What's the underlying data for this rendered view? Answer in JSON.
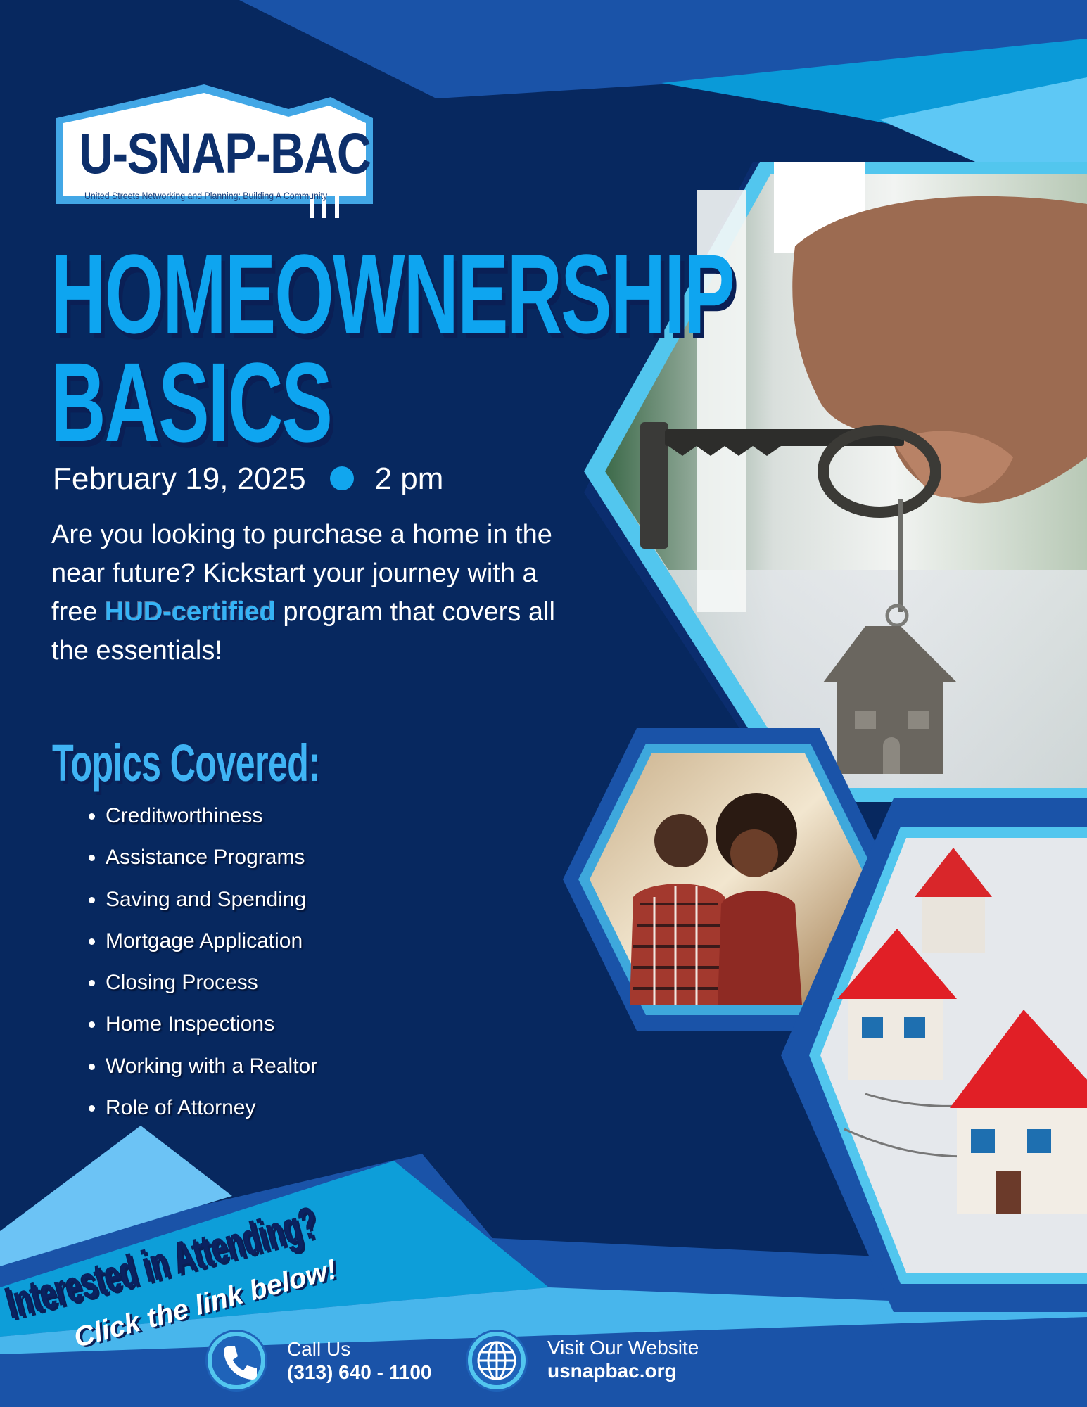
{
  "logo": {
    "title": "U-SNAP-BAC",
    "subtitle": "United Streets Networking and Planning; Building A Community"
  },
  "headline": {
    "line1": "HOMEOWNERSHIP",
    "line2": "BASICS"
  },
  "event": {
    "date": "February 19, 2025",
    "time": "2 pm"
  },
  "intro": {
    "part1": "Are you looking to purchase a home in the near future? Kickstart your journey with a free",
    "highlight": "HUD-certified",
    "part2": "program that covers all the essentials!"
  },
  "topics": {
    "heading": "Topics Covered:",
    "items": [
      "Creditworthiness",
      "Assistance Programs",
      "Saving and Spending",
      "Mortgage Application",
      "Closing Process",
      "Home Inspections",
      "Working with a Realtor",
      "Role of Attorney"
    ]
  },
  "cta": {
    "line1": "Interested in Attending?",
    "line2": "Click the link below!"
  },
  "contact": {
    "phone_label": "Call Us",
    "phone": "(313) 640 - 1100",
    "web_label": "Visit Our Website",
    "web": "usnapbac.org"
  },
  "colors": {
    "navy": "#07285f",
    "bright_blue": "#0ea5f0",
    "light_blue": "#3fb4f4",
    "royal_blue": "#1a53a8",
    "cyan": "#52c6ee"
  }
}
